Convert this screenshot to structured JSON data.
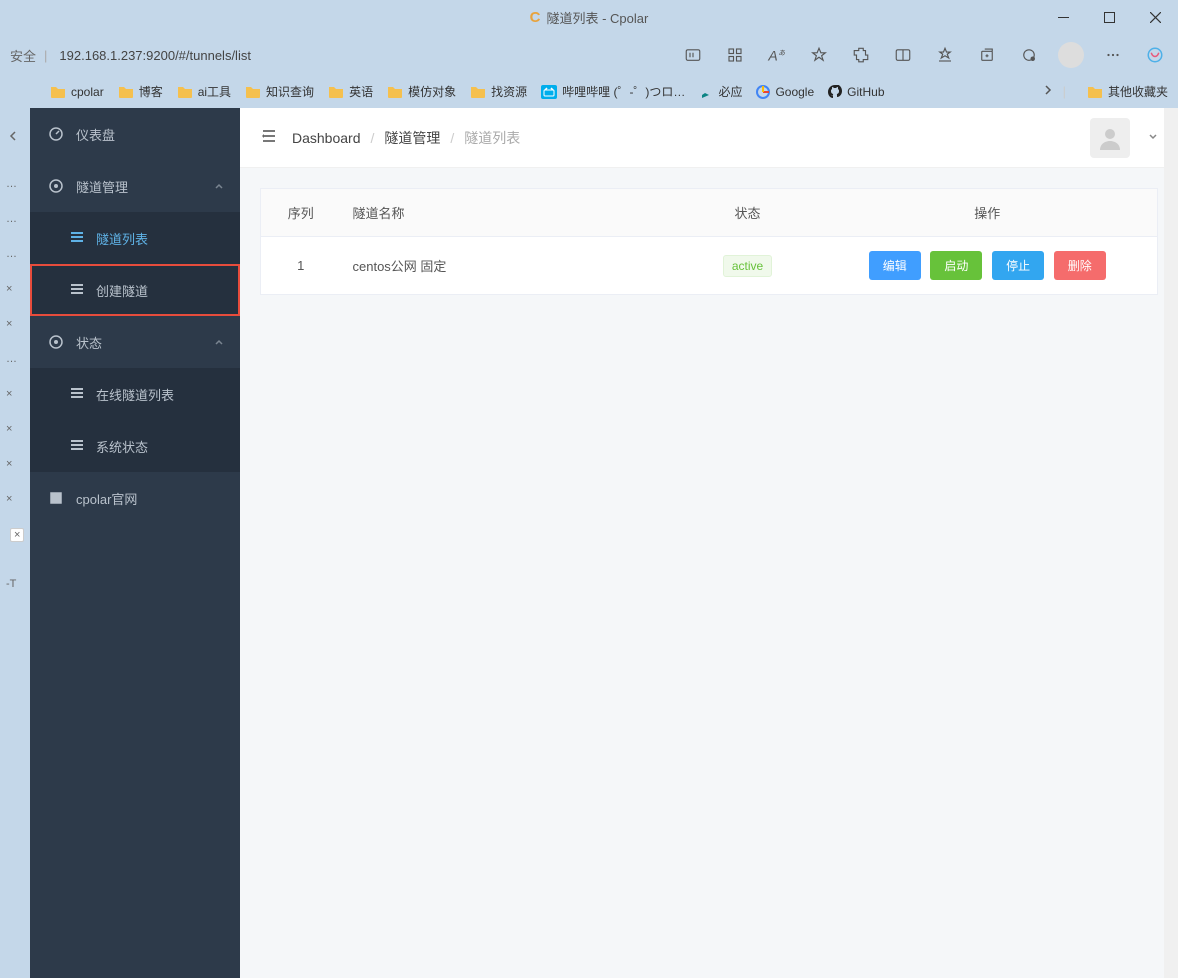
{
  "window": {
    "title": "隧道列表 - Cpolar",
    "security_label": "安全",
    "url": "192.168.1.237:9200/#/tunnels/list"
  },
  "bookmarks": [
    {
      "label": "cpolar",
      "type": "folder"
    },
    {
      "label": "博客",
      "type": "folder"
    },
    {
      "label": "ai工具",
      "type": "folder"
    },
    {
      "label": "知识查询",
      "type": "folder"
    },
    {
      "label": "英语",
      "type": "folder"
    },
    {
      "label": "模仿对象",
      "type": "folder"
    },
    {
      "label": "找资源",
      "type": "folder"
    },
    {
      "label": "哔哩哔哩 (゜-゜)つロ…",
      "type": "site",
      "icon": "bili"
    },
    {
      "label": "必应",
      "type": "site",
      "icon": "bing"
    },
    {
      "label": "Google",
      "type": "site",
      "icon": "google"
    },
    {
      "label": "GitHub",
      "type": "site",
      "icon": "github"
    }
  ],
  "bookmarks_other": "其他收藏夹",
  "leftstrip": {
    "items": [
      "…",
      "…",
      "…",
      "×",
      "×",
      "…",
      "×",
      "×",
      "×",
      "×"
    ],
    "tail": "-T"
  },
  "sidenav": {
    "dashboard": "仪表盘",
    "tunnel_mgmt": "隧道管理",
    "tunnel_list": "隧道列表",
    "create_tunnel": "创建隧道",
    "status": "状态",
    "online_list": "在线隧道列表",
    "sys_status": "系统状态",
    "official": "cpolar官网"
  },
  "breadcrumb": {
    "dashboard": "Dashboard",
    "tunnel_mgmt": "隧道管理",
    "tunnel_list": "隧道列表"
  },
  "table": {
    "headers": {
      "seq": "序列",
      "name": "隧道名称",
      "status": "状态",
      "actions": "操作"
    },
    "rows": [
      {
        "seq": "1",
        "name": "centos公网 固定",
        "status": "active",
        "actions": {
          "edit": "编辑",
          "start": "启动",
          "stop": "停止",
          "delete": "删除"
        }
      }
    ]
  }
}
